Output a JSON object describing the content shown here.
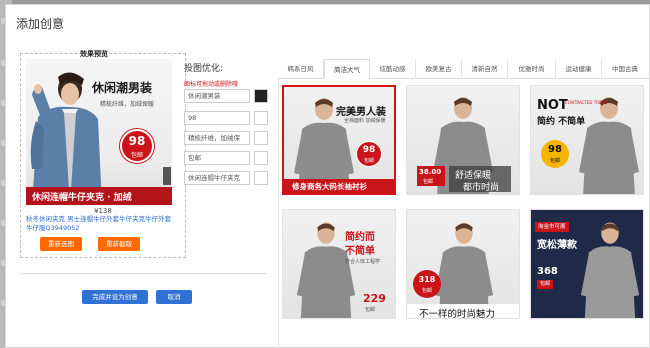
{
  "dialog": {
    "title": "添加创意"
  },
  "preview": {
    "title": "效果预览",
    "ad": {
      "headline": "休闲潮男装",
      "subline": "精梳纤维，加绒保暖",
      "price": "98",
      "price_tag": "包邮",
      "banner": "休闲连帽牛仔夹克 · 加绒",
      "badge_color": "#c9141a"
    },
    "price": "¥138",
    "description": "秋冬休闲夹克 男士连帽牛仔外套牛仔夹克牛仔外套牛仔服Q3949052",
    "buttons": {
      "reselect_image": "重新选图",
      "reselect_template": "重新截取"
    }
  },
  "optimize": {
    "title": "投图优化:",
    "hint": "图标可拖动或删除哦",
    "fields": [
      {
        "value": "休闲潮男装"
      },
      {
        "value": "98"
      },
      {
        "value": "精梳纤维，加绒保"
      },
      {
        "value": "包邮"
      },
      {
        "value": "休闲连帽牛仔夹克"
      }
    ]
  },
  "tabs": [
    "韩系日风",
    "简洁大气",
    "炫酷动感",
    "欧美复古",
    "清新自然",
    "优雅时尚",
    "运动健康",
    "中国古典"
  ],
  "active_tab": 1,
  "templates": [
    {
      "text1": "完美男人装",
      "text2": "全棉面料 加绒保暖",
      "price": "98",
      "tag": "包邮",
      "banner": "修身商务大码长袖衬衫"
    },
    {
      "price": "38.00",
      "tag": "包邮",
      "text1": "舒适保暖",
      "text2": "都市时尚"
    },
    {
      "text1": "NOT",
      "text2": "简约 不简单",
      "price": "98",
      "tag": "包邮",
      "sub": "CONTRACTED TREND"
    },
    {
      "text1": "简约而",
      "text2": "不简单",
      "text3": "符合人体工程学",
      "price": "229",
      "tag": "包邮"
    },
    {
      "price": "318",
      "tag": "包邮",
      "text1": "不一样的时尚魅力"
    },
    {
      "tag1": "淘金市可展",
      "text1": "宽松薄款",
      "price": "368",
      "tag": "包邮"
    }
  ],
  "footer": {
    "confirm": "完成并设为创意",
    "cancel": "取消"
  },
  "colors": {
    "accent_orange": "#ff6a00",
    "accent_blue": "#2f72d4",
    "brand_red": "#c9141a"
  }
}
